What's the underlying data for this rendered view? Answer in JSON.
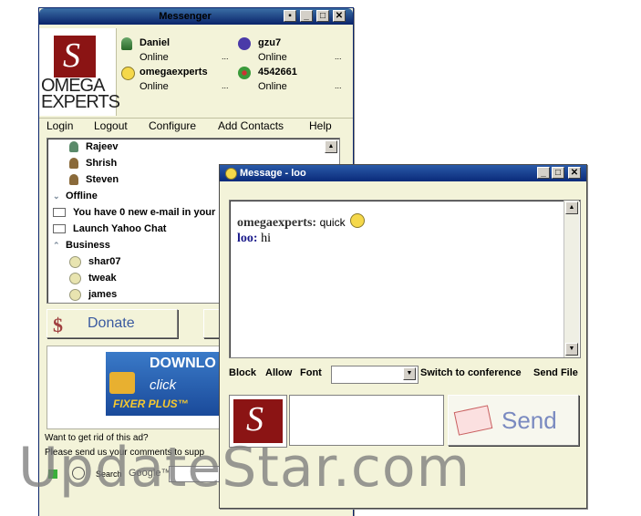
{
  "main_window": {
    "title": "Messenger",
    "logo": {
      "line1": "OMEGA",
      "line2": "EXPERTS"
    },
    "contacts_top": [
      {
        "name": "Daniel",
        "status": "Online",
        "more": "..."
      },
      {
        "name": "gzu7",
        "status": "Online",
        "more": "..."
      },
      {
        "name": "omegaexperts",
        "status": "Online",
        "more": "..."
      },
      {
        "name": "4542661",
        "status": "Online",
        "more": "..."
      }
    ],
    "menu": [
      "Login",
      "Logout",
      "Configure",
      "Add Contacts",
      "Help"
    ],
    "list": {
      "users": [
        "Rajeev",
        "Shrish",
        "Steven"
      ],
      "offline_label": "Offline",
      "email_notice": "You have 0 new e-mail in your",
      "launch_chat": "Launch Yahoo Chat",
      "group_label": "Business",
      "group_users": [
        "shar07",
        "tweak",
        "james"
      ]
    },
    "donate_label": "Donate",
    "ad": {
      "line1": "DOWNLO",
      "line2": "click",
      "line3": "FIXER PLUS™"
    },
    "ad_prompt": "Want to get rid of this ad?",
    "comments_prompt": "Please send us your comments to supp",
    "search_label": "Search",
    "search_brand": "Google™"
  },
  "message_window": {
    "title": "Message - loo",
    "conversation": [
      {
        "sender": "omegaexperts:",
        "text": "quick"
      },
      {
        "sender": "loo:",
        "text": "hi"
      }
    ],
    "toolbar": [
      "Block",
      "Allow",
      "Font"
    ],
    "font_select_value": "",
    "switch_label": "Switch to conference",
    "send_file_label": "Send File",
    "compose_value": "",
    "send_label": "Send"
  },
  "watermark": "UpdateStar.com",
  "colors": {
    "title_active": "#0a246a",
    "window_bg": "#f3f3d9",
    "sender_omega": "#000000",
    "sender_loo": "#1a1a8a"
  }
}
